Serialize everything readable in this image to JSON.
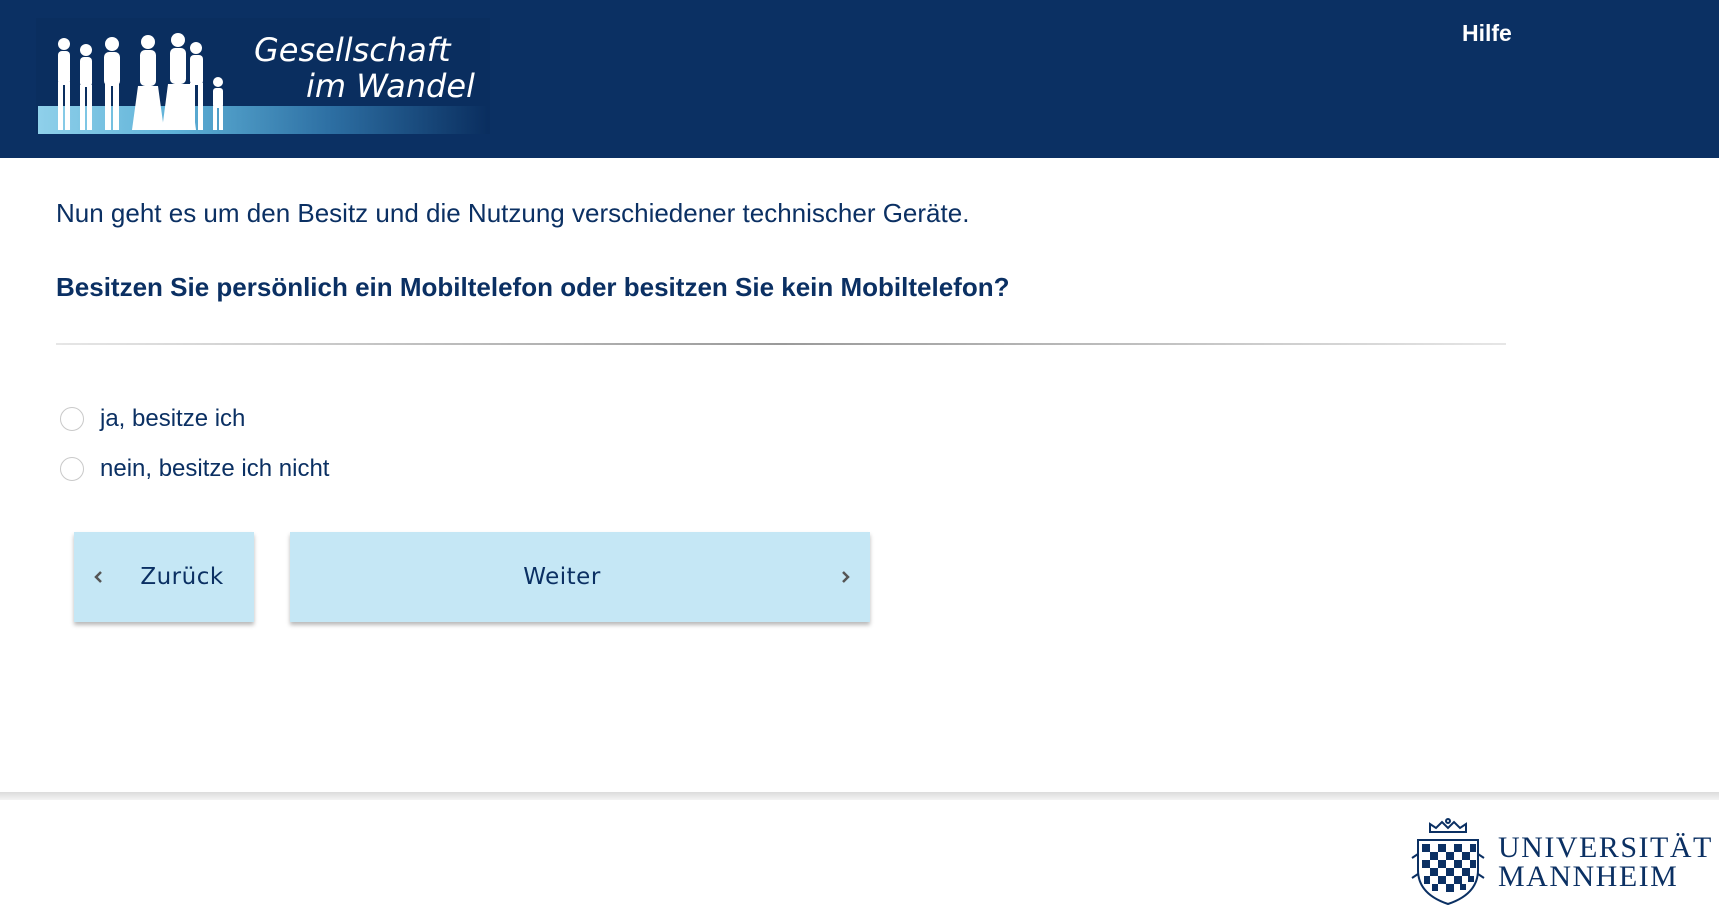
{
  "header": {
    "logo_line1": "Gesellschaft",
    "logo_line2": "im Wandel",
    "help_label": "Hilfe"
  },
  "question": {
    "intro": "Nun geht es um den Besitz und die Nutzung verschiedener technischer Geräte.",
    "text": "Besitzen Sie persönlich ein Mobiltelefon oder besitzen Sie kein Mobiltelefon?",
    "options": [
      {
        "label": "ja, besitze ich",
        "selected": false
      },
      {
        "label": "nein, besitze ich nicht",
        "selected": false
      }
    ]
  },
  "navigation": {
    "back_label": "Zurück",
    "next_label": "Weiter"
  },
  "footer": {
    "university_line1": "UNIVERSITÄT",
    "university_line2": "MANNHEIM"
  },
  "colors": {
    "header_bg": "#0b3063",
    "text": "#0b3063",
    "button_bg": "#c5e7f5"
  }
}
